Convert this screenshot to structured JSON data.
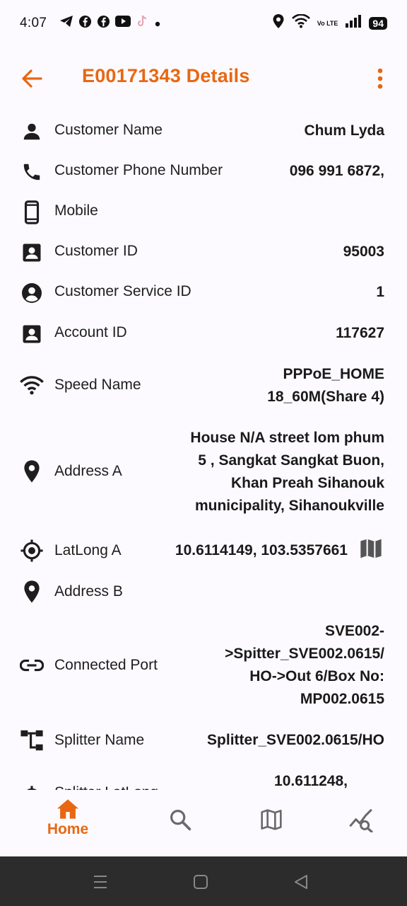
{
  "status_bar": {
    "time": "4:07",
    "battery": "94",
    "network": "Vo LTE",
    "icons_left": [
      "telegram-icon",
      "facebook-icon",
      "facebook-icon",
      "youtube-icon",
      "tiktok-icon",
      "dot-icon"
    ],
    "icons_right": [
      "location-icon",
      "wifi-icon",
      "volte-icon",
      "signal-icon",
      "battery-icon"
    ]
  },
  "app_bar": {
    "title": "E00171343 Details",
    "accent_color": "#e86712"
  },
  "details": [
    {
      "label": "Customer Name",
      "value": "Chum Lyda",
      "icon": "person-icon"
    },
    {
      "label": "Customer Phone Number",
      "value": "096 991 6872,",
      "icon": "phone-icon"
    },
    {
      "label": "Mobile",
      "value": "",
      "icon": "mobile-icon"
    },
    {
      "label": "Customer ID",
      "value": "95003",
      "icon": "badge-icon"
    },
    {
      "label": "Customer Service ID",
      "value": "1",
      "icon": "account-circle-icon"
    },
    {
      "label": "Account ID",
      "value": "117627",
      "icon": "badge-icon"
    },
    {
      "label": "Speed Name",
      "value_lines": [
        "PPPoE_HOME",
        "18_60M(Share 4)"
      ],
      "icon": "wifi-icon"
    },
    {
      "label": "Address A",
      "value_lines": [
        "House N/A street lom phum",
        "5 , Sangkat Sangkat Buon,",
        "Khan Preah Sihanouk",
        "municipality, Sihanoukville"
      ],
      "icon": "location-pin-icon"
    },
    {
      "label": "LatLong A",
      "value": "10.6114149, 103.5357661",
      "icon": "gps-icon"
    },
    {
      "label": "Address B",
      "value": "",
      "icon": "location-pin-icon"
    },
    {
      "label": "Connected Port",
      "value_lines": [
        "SVE002-",
        ">Spitter_SVE002.0615/",
        "HO->Out 6/Box No:",
        "MP002.0615"
      ],
      "icon": "link-icon"
    },
    {
      "label": "Splitter Name",
      "value": "Splitter_SVE002.0615/HO",
      "icon": "splitter-icon"
    },
    {
      "label": "Splitter LatLong",
      "value": "10.611248,",
      "icon": "gps-icon"
    }
  ],
  "bottom_nav": {
    "items": [
      {
        "label": "Home",
        "icon": "home-icon",
        "active": true
      },
      {
        "label": "",
        "icon": "search-icon",
        "active": false
      },
      {
        "label": "",
        "icon": "map-icon",
        "active": false
      },
      {
        "label": "",
        "icon": "analytics-icon",
        "active": false
      }
    ]
  }
}
